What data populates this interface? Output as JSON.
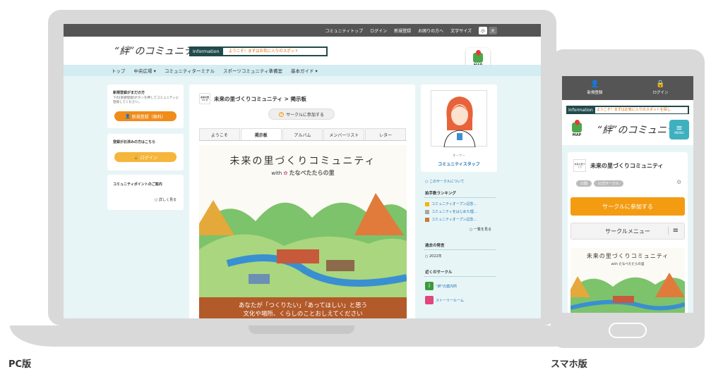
{
  "pc": {
    "topbar": [
      "コミュニティトップ",
      "ログイン",
      "新規登録",
      "お困りの方へ",
      "文字サイズ"
    ],
    "font_size_small": "小",
    "font_size_large": "大",
    "logo": "“絆”のコミュニティ",
    "info_label": "Information",
    "info_message": "ようこそ！まずはお気に入りのスポット",
    "map_label": "MAP",
    "nav": [
      "トップ",
      "中央広場 ▾",
      "コミュニティターミナル",
      "スポーツコミュニティ準備室",
      "基本ガイド ▾"
    ],
    "left": {
      "register_title": "新規登録がまだの方",
      "register_sub": "下の[新規登録]ボタンを押してコミュニティに登録してください。",
      "register_button": "新規登録（無料）",
      "login_title": "登録がお済みの方はこちら",
      "login_button": "ログイン",
      "points_title": "コミュニティポイントのご案内",
      "points_link": "詳しく見る"
    },
    "center": {
      "mini_logo": "未来の里づくり",
      "breadcrumb": "未来の里づくりコミュニティ > 掲示板",
      "join_button": "サークルに参加する",
      "tabs": [
        "ようこそ",
        "掲示板",
        "アルバム",
        "メンバーリスト",
        "レター"
      ],
      "active_tab": 1,
      "banner_title": "未来の里づくりコミュニティ",
      "banner_with": "with",
      "banner_partner": "たなべたたらの里",
      "banner_bottom_1": "あなたが「つくりたい」「あってほしい」と思う",
      "banner_bottom_2": "文化や場所、くらしのことおしえてください"
    },
    "right": {
      "owner_role": "オーナー",
      "owner_name": "コミュニティスタッフ",
      "about_link": "このサークルについて",
      "ranking_title": "拍手数ランキング",
      "ranking": [
        "コミュニティオープン記念…",
        "コミュニティをはじめた理…",
        "コミュニティオープン記念…"
      ],
      "ranking_more": "一覧を見る",
      "past_title": "過去の発言",
      "past_year": "2022年",
      "nearby_title": "近くのサークル",
      "nearby": [
        "“絆”の案内所",
        "ストーリールーム"
      ]
    },
    "rank_colors": [
      "#f2b705",
      "#a6a6a6",
      "#c57a3c"
    ]
  },
  "sp": {
    "register": "新規登録",
    "login": "ログイン",
    "info_label": "Information",
    "info_message": "ようこそ！まずはお気に入りのスポットを探し",
    "map_label": "MAP",
    "logo": "“絆”のコミュニティ",
    "menu_label": "MENU",
    "mini_logo": "未来の里づくり",
    "title": "未来の里づくりコミュニティ",
    "tags": [
      "公開",
      "公式サークル"
    ],
    "join_button": "サークルに参加する",
    "circle_menu": "サークルメニュー",
    "banner_title": "未来の里づくりコミュニティ",
    "banner_with": "with たなべたたらの里"
  },
  "captions": {
    "pc": "PC版",
    "sp": "スマホ版"
  }
}
